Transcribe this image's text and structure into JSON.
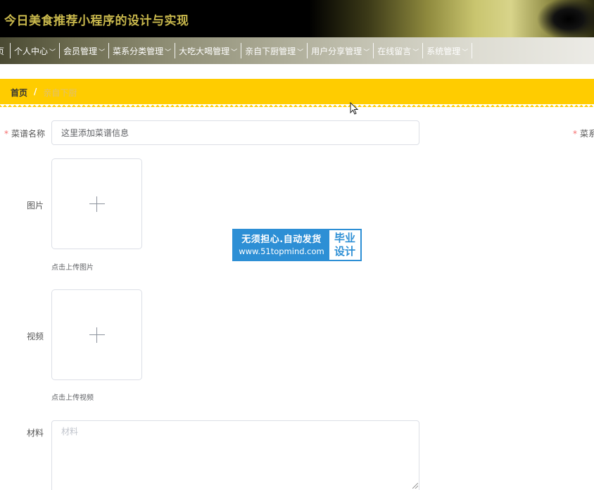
{
  "app": {
    "title": "今日美食推荐小程序的设计与实现"
  },
  "nav": {
    "items": [
      {
        "label": "页",
        "has_dropdown": false
      },
      {
        "label": "个人中心",
        "has_dropdown": true
      },
      {
        "label": "会员管理",
        "has_dropdown": true
      },
      {
        "label": "菜系分类管理",
        "has_dropdown": true
      },
      {
        "label": "大吃大喝管理",
        "has_dropdown": true
      },
      {
        "label": "亲自下厨管理",
        "has_dropdown": true
      },
      {
        "label": "用户分享管理",
        "has_dropdown": true
      },
      {
        "label": "在线留言",
        "has_dropdown": true
      },
      {
        "label": "系统管理",
        "has_dropdown": true
      }
    ]
  },
  "breadcrumb": {
    "home": "首页",
    "separator": "/",
    "current": "亲自下厨"
  },
  "form": {
    "name": {
      "label": "菜谱名称",
      "required_mark": "*",
      "value": "这里添加菜谱信息"
    },
    "right_field": {
      "label": "菜系",
      "required_mark": "*"
    },
    "image": {
      "label": "图片",
      "hint": "点击上传图片"
    },
    "video": {
      "label": "视频",
      "hint": "点击上传视频"
    },
    "materials": {
      "label": "材料",
      "placeholder": "材料"
    }
  },
  "watermark": {
    "line1": "无须担心.自动发货",
    "line2": "www.51topmind.com",
    "side1": "毕业",
    "side2": "设计"
  },
  "colors": {
    "breadcrumb_bg": "#ffcc00",
    "required": "#f56c6c",
    "watermark_blue": "#2d8fd5",
    "title_gold": "#c9b84c"
  }
}
